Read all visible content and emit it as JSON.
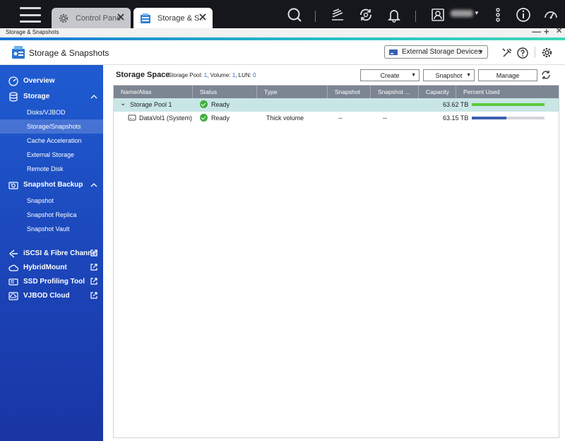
{
  "taskbar": {
    "tabs": [
      {
        "label": "Control Panel",
        "icon": "gear-icon"
      },
      {
        "label": "Storage & S...",
        "icon": "storage-icon"
      }
    ],
    "icons": [
      "search-icon",
      "tasks-icon",
      "sync-icon",
      "bell-icon",
      "user-icon",
      "more-icon",
      "info-icon",
      "dashboard-icon"
    ]
  },
  "window": {
    "title": "Storage & Snapshots",
    "controls": {
      "minimize": "—",
      "maximize": "+",
      "close": "✕"
    }
  },
  "app": {
    "title": "Storage & Snapshots",
    "external_button": "External Storage Devices"
  },
  "sidebar": {
    "items": [
      {
        "label": "Overview",
        "icon": "gauge-icon"
      },
      {
        "label": "Storage",
        "icon": "database-icon"
      },
      {
        "label": "Disks/VJBOD"
      },
      {
        "label": "Storage/Snapshots"
      },
      {
        "label": "Cache Acceleration"
      },
      {
        "label": "External Storage"
      },
      {
        "label": "Remote Disk"
      },
      {
        "label": "Snapshot Backup",
        "icon": "snapshot-icon"
      },
      {
        "label": "Snapshot"
      },
      {
        "label": "Snapshot Replica"
      },
      {
        "label": "Snapshot Vault"
      },
      {
        "label": "iSCSI & Fibre Channel",
        "icon": "iscsi-icon"
      },
      {
        "label": "HybridMount",
        "icon": "cloud-icon"
      },
      {
        "label": "SSD Profiling Tool",
        "icon": "ssd-icon"
      },
      {
        "label": "VJBOD Cloud",
        "icon": "vjbod-cloud-icon"
      }
    ]
  },
  "main": {
    "title": "Storage Space",
    "info": {
      "pool_label": "Storage Pool: ",
      "pool_count": "1",
      "volume_label": ", Volume: ",
      "volume_count": "1",
      "lun_label": ", LUN: ",
      "lun_count": "0"
    },
    "toolbar": {
      "create": "Create",
      "snapshot": "Snapshot",
      "manage": "Manage"
    },
    "columns": [
      "Name/Alias",
      "Status",
      "Type",
      "Snapshot",
      "Snapshot ...",
      "Capacity",
      "Percent Used"
    ],
    "rows": [
      {
        "name": "Storage Pool 1",
        "status": "Ready",
        "type": "",
        "snapshot": "",
        "snapshot2": "",
        "capacity": "63.62 TB",
        "percent_used": 1.0,
        "bar_color": "#5cc93d"
      },
      {
        "name": "DataVol1 (System)",
        "status": "Ready",
        "type": "Thick volume",
        "snapshot": "--",
        "snapshot2": "--",
        "capacity": "63.15 TB",
        "percent_used": 0.48,
        "bar_color": "#3a5fb0"
      }
    ]
  }
}
